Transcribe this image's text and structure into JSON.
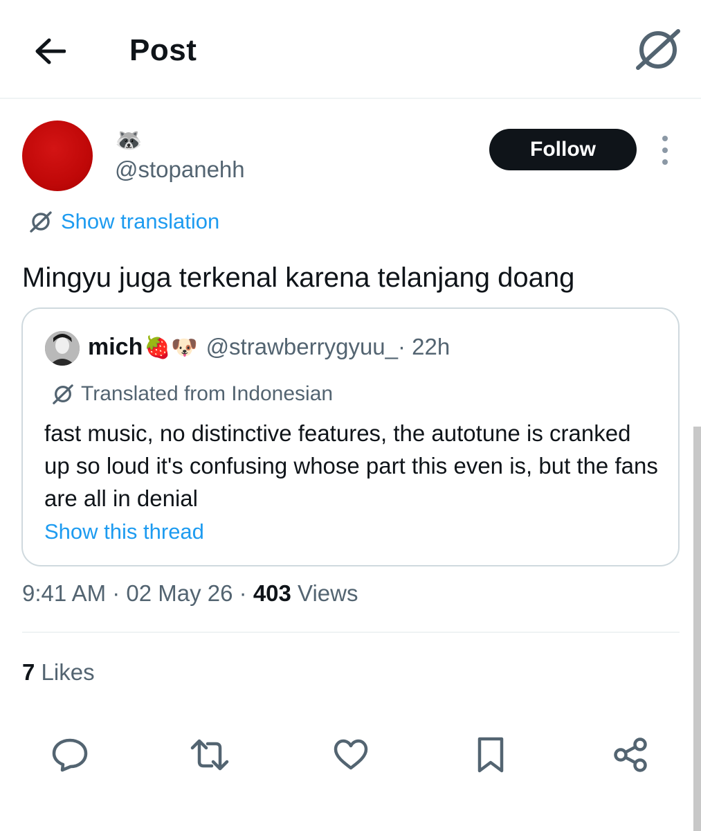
{
  "header": {
    "title": "Post"
  },
  "post": {
    "author_display_name": "🦝",
    "author_handle": "@stopanehh",
    "follow_label": "Follow",
    "show_translation_label": "Show translation",
    "text": "Mingyu juga terkenal karena telanjang doang",
    "meta": {
      "time": "9:41 AM",
      "separator": " · ",
      "date": "02 May 26",
      "views_count": "403",
      "views_label": " Views"
    },
    "likes": {
      "count": "7",
      "label": " Likes"
    }
  },
  "quote": {
    "name": "mich",
    "emojis": "🍓🐶",
    "handle": "@strawberrygyuu_",
    "time": " · 22h",
    "translated_label": "Translated from Indonesian",
    "text": "fast music, no distinctive features, the autotune is cranked up so loud it's confusing whose part this even is, but the fans are all in denial",
    "show_thread_label": "Show this thread"
  },
  "colors": {
    "link_blue": "#1d9bf0",
    "text_primary": "#0f1419",
    "text_secondary": "#536471",
    "follow_bg": "#0f1419",
    "avatar_red": "#c00808"
  },
  "icons": {
    "back": "arrow-left-icon",
    "translate": "translate-icon",
    "more": "more-vertical-icon",
    "reply": "reply-icon",
    "repost": "repost-icon",
    "like": "heart-icon",
    "bookmark": "bookmark-icon",
    "share": "share-icon"
  }
}
